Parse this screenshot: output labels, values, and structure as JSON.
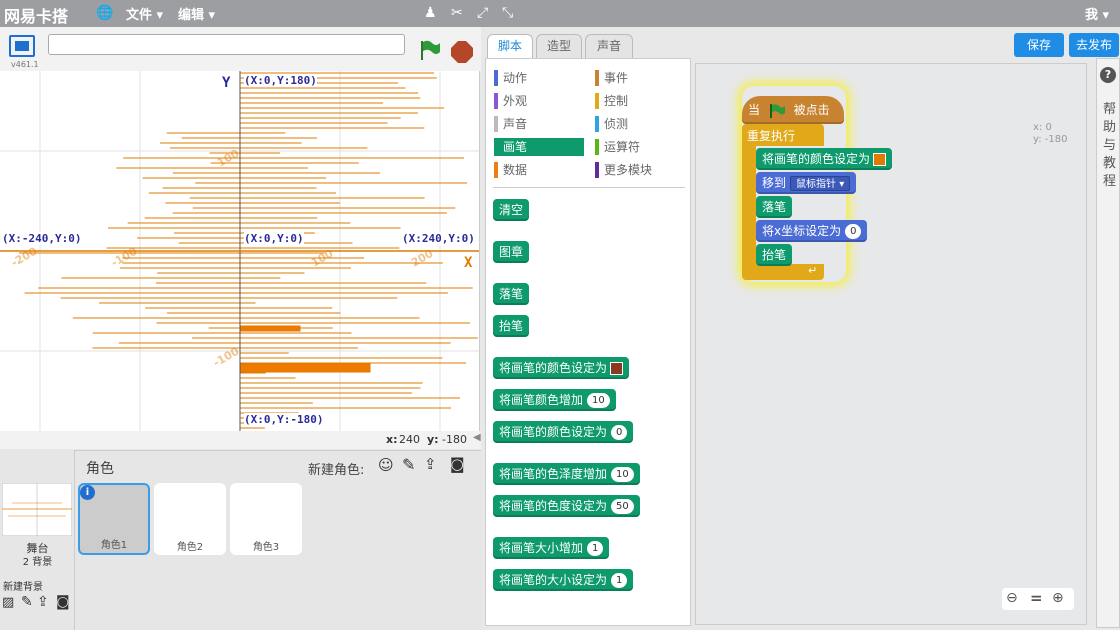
{
  "app": {
    "logo": "网易卡搭",
    "menu_file": "文件",
    "menu_edit": "编辑",
    "user": "我"
  },
  "stage": {
    "version": "v461.1",
    "title_value": "",
    "labels": {
      "top": "(X:0,Y:180)",
      "left": "(X:-240,Y:0)",
      "center": "(X:0,Y:0)",
      "right": "(X:240,Y:0)",
      "bottom": "(X:0,Y:-180)",
      "y_axis": "Y",
      "x_axis": "X"
    },
    "ticks": {
      "-200": "-200",
      "-100": "-100",
      "100": "100",
      "200": "200",
      "y100": "100",
      "y-100": "-100"
    },
    "coord_x_label": "x:",
    "coord_x": "240",
    "coord_y_label": "y:",
    "coord_y": "-180"
  },
  "sprites": {
    "header": "角色",
    "new_label": "新建角色:",
    "stage_name": "舞台",
    "stage_bg_count": "2 背景",
    "new_bg_label": "新建背景",
    "items": [
      "角色1",
      "角色2",
      "角色3"
    ]
  },
  "tabs": [
    "脚本",
    "造型",
    "声音"
  ],
  "buttons": {
    "save": "保存",
    "publish": "去发布"
  },
  "categories": [
    {
      "label": "动作",
      "color": "#4a6cd4"
    },
    {
      "label": "事件",
      "color": "#c88330"
    },
    {
      "label": "外观",
      "color": "#8a55d7"
    },
    {
      "label": "控制",
      "color": "#e1a91a"
    },
    {
      "label": "声音",
      "color": "#bbbbbb"
    },
    {
      "label": "侦测",
      "color": "#2ca5e2"
    },
    {
      "label": "画笔",
      "color": "#0e9a6c"
    },
    {
      "label": "运算符",
      "color": "#5cb712"
    },
    {
      "label": "数据",
      "color": "#ee7d16"
    },
    {
      "label": "更多模块",
      "color": "#632d99"
    }
  ],
  "palette_blocks": {
    "clear": "清空",
    "stamp": "图章",
    "pen_down": "落笔",
    "pen_up": "抬笔",
    "set_color": "将画笔的颜色设定为",
    "change_color": "将画笔颜色增加",
    "change_color_val": "10",
    "set_color_num": "将画笔的颜色设定为",
    "set_color_num_val": "0",
    "change_shade": "将画笔的色泽度增加",
    "change_shade_val": "10",
    "set_shade": "将画笔的色度设定为",
    "set_shade_val": "50",
    "change_size": "将画笔大小增加",
    "change_size_val": "1",
    "set_size": "将画笔的大小设定为",
    "set_size_val": "1"
  },
  "script": {
    "hat_when": "当",
    "hat_clicked": "被点击",
    "forever": "重复执行",
    "set_color": "将画笔的颜色设定为",
    "goto": "移到",
    "goto_target": "鼠标指针",
    "pen_down": "落笔",
    "set_x": "将x坐标设定为",
    "set_x_val": "0",
    "pen_up": "抬笔"
  },
  "sprite_info": {
    "x_label": "x: 0",
    "y_label": "y: -180"
  },
  "help_text": "帮助与教程",
  "colors": {
    "accent": "#1f8ce6",
    "pen": "#0e9a6c",
    "control": "#e1a91a",
    "line": "#e07b00"
  }
}
